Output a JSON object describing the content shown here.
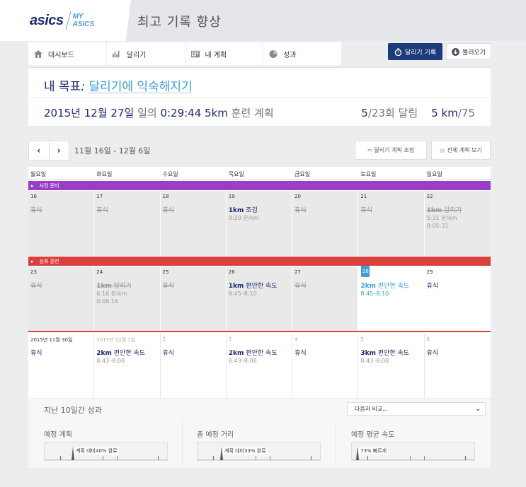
{
  "header": {
    "logo_brand": "asics",
    "logo_my": "MY",
    "logo_asics": "ASICS",
    "page_title": "최고 기록 향상"
  },
  "nav": [
    {
      "label": "대시보드",
      "icon": "home-icon"
    },
    {
      "label": "달리기",
      "icon": "bar-chart-icon"
    },
    {
      "label": "내 계획",
      "icon": "calendar-grid-icon"
    },
    {
      "label": "성과",
      "icon": "pie-icon"
    }
  ],
  "actions": {
    "record_label": "달리기 기록",
    "load_label": "불러오기"
  },
  "goal": {
    "prefix": "내 목표",
    "colon": ":",
    "link": "달리기에 익숙해지기",
    "plan_date": "2015년 12월 27일",
    "plan_mid": " 일의 ",
    "plan_time": "0:29:44",
    "plan_dist": " 5km",
    "plan_suffix": " 훈련 계획",
    "count_done": "5",
    "count_total": "/23회 달림",
    "dist_done": "5 km",
    "dist_total": "/75"
  },
  "calendar": {
    "week_range": "11월 16일 - 12월 6일",
    "adjust_label": "달리기 계획 조정",
    "view_all_label": "전체 계획 보기",
    "weekdays": [
      "월요일",
      "화요일",
      "수요일",
      "목요일",
      "금요일",
      "토요일",
      "일요일"
    ],
    "phases": {
      "prep": "사전 준비",
      "deep": "심화 훈련"
    },
    "week1": [
      {
        "date": "16",
        "rest": "휴식"
      },
      {
        "date": "17",
        "rest": "휴식"
      },
      {
        "date": "18",
        "rest": "휴식"
      },
      {
        "date": "19",
        "dist": "1km",
        "title": " 조깅",
        "pace": "9:20 분/km"
      },
      {
        "date": "20",
        "rest": "휴식"
      },
      {
        "date": "21",
        "rest": "휴식"
      },
      {
        "date": "22",
        "dist": "1km",
        "title": " 달리기",
        "pace": "5:31 분/km",
        "time": "0:05:31"
      }
    ],
    "week2": [
      {
        "date": "23",
        "rest": "휴식"
      },
      {
        "date": "24",
        "dist": "1km",
        "title": " 달리기",
        "pace": "6:16 분/km",
        "time": "0:06:16"
      },
      {
        "date": "25",
        "rest": "휴식"
      },
      {
        "date": "26",
        "dist": "1km",
        "title": " 편안한 속도",
        "pace": "8:45–8:10"
      },
      {
        "date": "27",
        "rest": "휴식"
      },
      {
        "date": "28",
        "dist": "2km",
        "title": " 편안한 속도",
        "pace": "8:45–8:10"
      },
      {
        "date": "29",
        "rest": "휴식"
      }
    ],
    "week3": [
      {
        "date": "2015년 11월 30일",
        "rest": "휴식"
      },
      {
        "date": "2015년 12월 1일",
        "dist": "2km",
        "title": " 편안한 속도",
        "pace": "8:43–8:08"
      },
      {
        "date": "2",
        "rest": "휴식"
      },
      {
        "date": "3",
        "dist": "2km",
        "title": " 편안한 속도",
        "pace": "8:43–8:08"
      },
      {
        "date": "4",
        "rest": "휴식"
      },
      {
        "date": "5",
        "dist": "3km",
        "title": " 편안한 속도",
        "pace": "8:43–8:08"
      },
      {
        "date": "6",
        "rest": "휴식"
      }
    ]
  },
  "performance": {
    "title": "지난 10일간 성과",
    "compare_label": "다음과 비교...",
    "metrics": [
      {
        "label": "예정 계획",
        "gauge_text": "계획 대비40% 완료",
        "level": 0.2
      },
      {
        "label": "총 예정 거리",
        "gauge_text": "계획 대비33% 완료",
        "level": 0.17
      },
      {
        "label": "예정 평균 속도",
        "gauge_text": "73% 빠르게",
        "level": 0.04
      }
    ]
  },
  "colors": {
    "navy": "#1a2a6c",
    "accent": "#3e9ed8",
    "prep": "#9a3ec8",
    "deep": "#d9413d"
  }
}
